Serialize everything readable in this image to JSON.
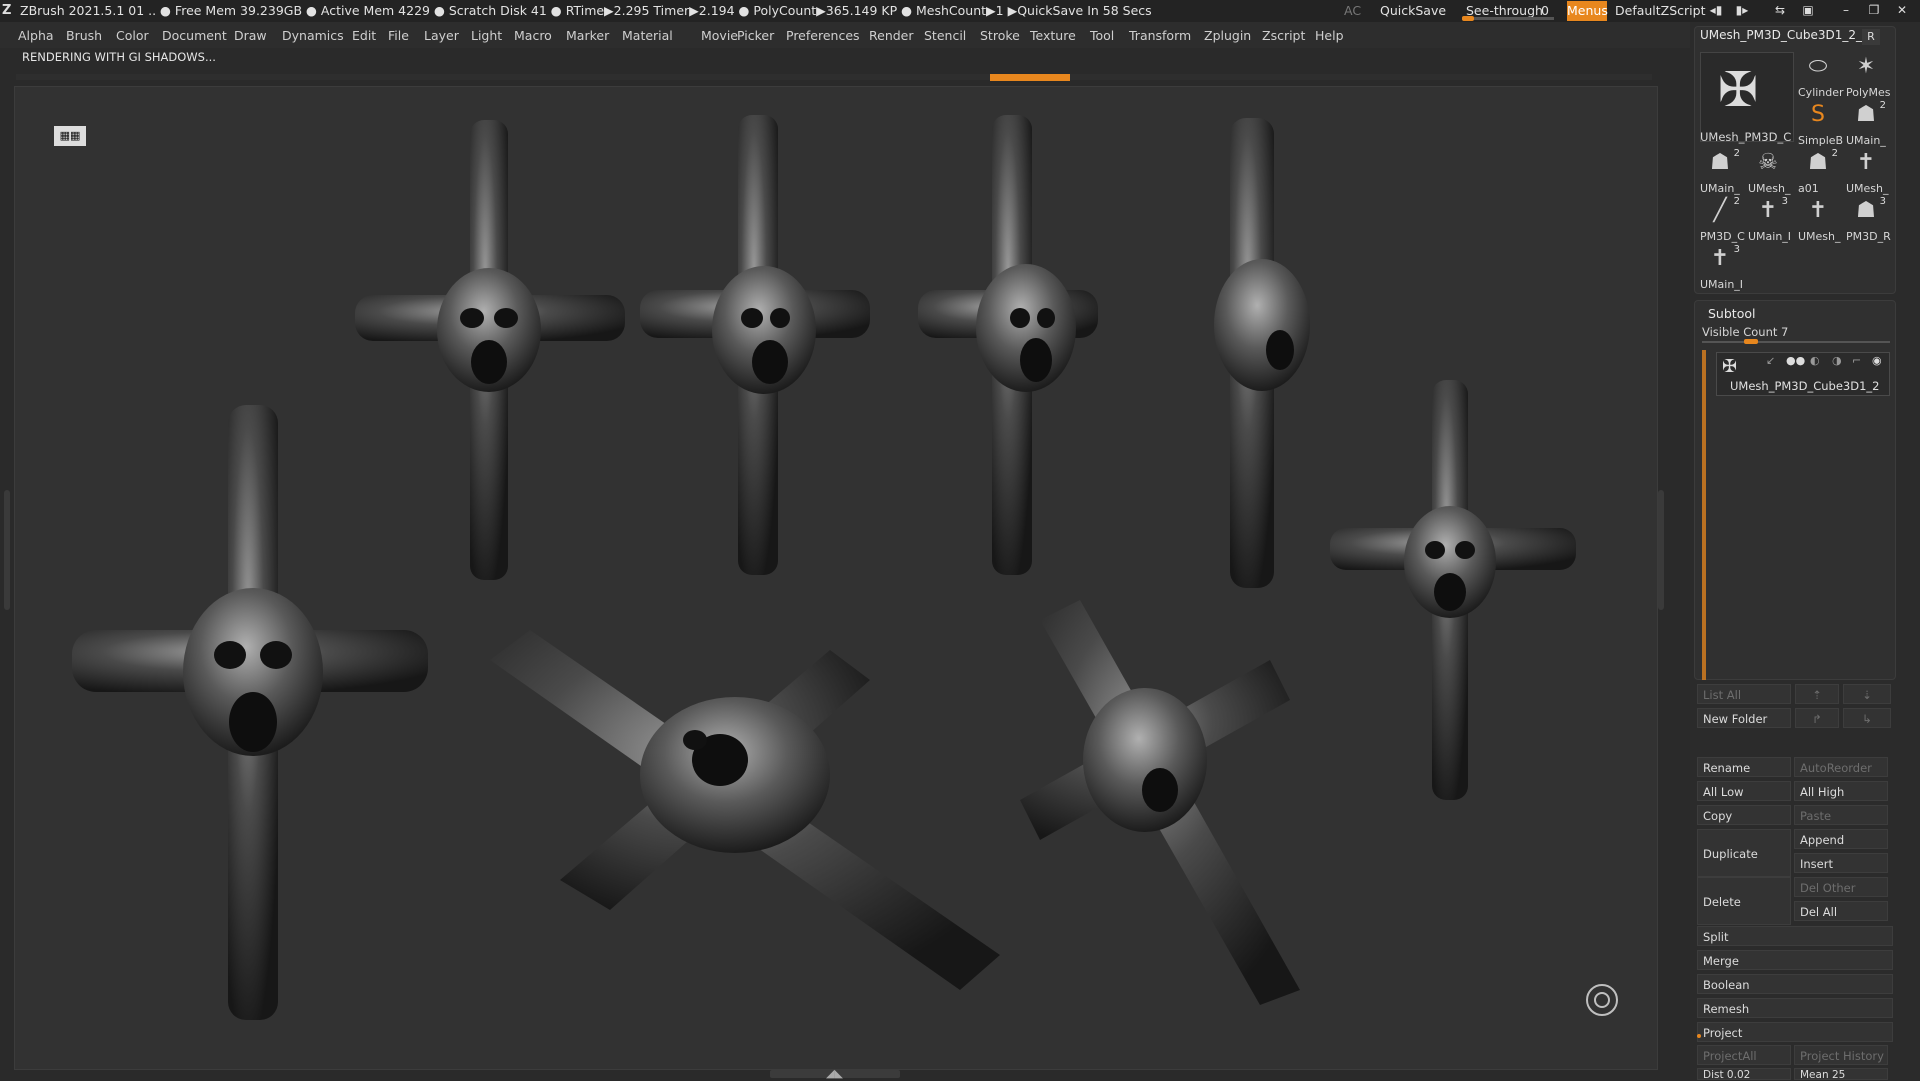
{
  "titlebar": {
    "status": "ZBrush 2021.5.1   01   .. ● Free Mem 39.239GB ● Active Mem 4229 ● Scratch Disk 41 ●  RTime▶2.295 Timer▶2.194 ● PolyCount▶365.149 KP  ● MeshCount▶1  ▶QuickSave In 58 Secs",
    "ac": "AC",
    "quicksave": "QuickSave",
    "seethrough_label": "See-through",
    "seethrough_value": "0",
    "seethrough_level": 0,
    "menus": "Menus",
    "script": "DefaultZScript"
  },
  "menubar": [
    "Alpha",
    "Brush",
    "Color",
    "Document",
    "Draw",
    "Dynamics",
    "Edit",
    "File",
    "Layer",
    "Light",
    "Macro",
    "Marker",
    "Material",
    "Movie",
    "Picker",
    "Preferences",
    "Render",
    "Stencil",
    "Stroke",
    "Texture",
    "Tool",
    "Transform",
    "Zplugin",
    "Zscript",
    "Help"
  ],
  "notice": "RENDERING WITH GI SHADOWS...",
  "doc_icon": "icon",
  "colors": {
    "accent": "#e8871e",
    "bg": "#2a2a2a",
    "viewport": "#323232"
  },
  "tool_panel": {
    "title": "UMesh_PM3D_Cube3D1_2_",
    "r_button": "R",
    "big_label": "UMesh_PM3D_C",
    "thumbs": [
      {
        "label": "Cylinder",
        "count": "",
        "icon": "cylinder-icon"
      },
      {
        "label": "PolyMes",
        "count": "",
        "icon": "star-icon"
      },
      {
        "label": "SimpleB",
        "count": "",
        "icon": "simplebrush-icon"
      },
      {
        "label": "UMain_",
        "count": "2",
        "icon": "bust-icon"
      },
      {
        "label": "UMain_",
        "count": "2",
        "icon": "bust-icon"
      },
      {
        "label": "UMesh_",
        "count": "",
        "icon": "skull-icon"
      },
      {
        "label": "a01",
        "count": "2",
        "icon": "bust-icon"
      },
      {
        "label": "UMesh_",
        "count": "",
        "icon": "cross-icon"
      },
      {
        "label": "PM3D_C",
        "count": "2",
        "icon": "stick-icon"
      },
      {
        "label": "UMain_I",
        "count": "3",
        "icon": "cross-icon"
      },
      {
        "label": "UMesh_",
        "count": "",
        "icon": "cross-icon"
      },
      {
        "label": "PM3D_R",
        "count": "3",
        "icon": "bust-icon"
      },
      {
        "label": "UMain_I",
        "count": "3",
        "icon": "cross-icon"
      }
    ]
  },
  "subtool": {
    "title": "Subtool",
    "visible_count": "Visible Count 7",
    "row_label": "UMesh_PM3D_Cube3D1_2",
    "list_all": "List All",
    "new_folder": "New Folder",
    "rename": "Rename",
    "autoreorder": "AutoReorder",
    "all_low": "All Low",
    "all_high": "All High",
    "copy": "Copy",
    "paste": "Paste",
    "duplicate": "Duplicate",
    "append": "Append",
    "insert": "Insert",
    "delete": "Delete",
    "del_other": "Del Other",
    "del_all": "Del All",
    "split": "Split",
    "merge": "Merge",
    "boolean": "Boolean",
    "remesh": "Remesh",
    "project": "Project",
    "project_all": "ProjectAll",
    "project_history": "Project History",
    "dist": "Dist 0.02",
    "mean": "Mean 25"
  }
}
